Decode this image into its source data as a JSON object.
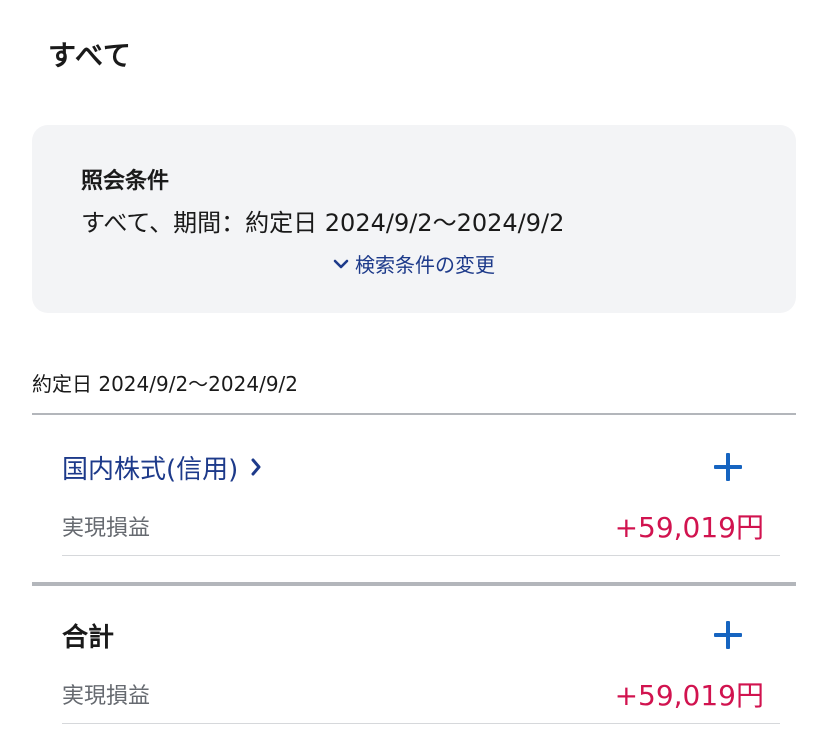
{
  "page": {
    "title": "すべて"
  },
  "conditions": {
    "title": "照会条件",
    "text": "すべて、期間：約定日 2024/9/2～2024/9/2",
    "change_link": "検索条件の変更"
  },
  "period": {
    "label": "約定日 2024/9/2～2024/9/2"
  },
  "sections": [
    {
      "title": "国内株式(信用)",
      "row_label": "実現損益",
      "row_value": "+59,019円"
    },
    {
      "title": "合計",
      "row_label": "実現損益",
      "row_value": "+59,019円"
    }
  ],
  "colors": {
    "link": "#1d3a8a",
    "plus": "#1664c0",
    "profit": "#d1134f",
    "box_bg": "#f3f4f6"
  },
  "icons": {
    "expand": "chevron-down-icon",
    "navigate": "chevron-right-icon",
    "add": "plus-icon"
  }
}
